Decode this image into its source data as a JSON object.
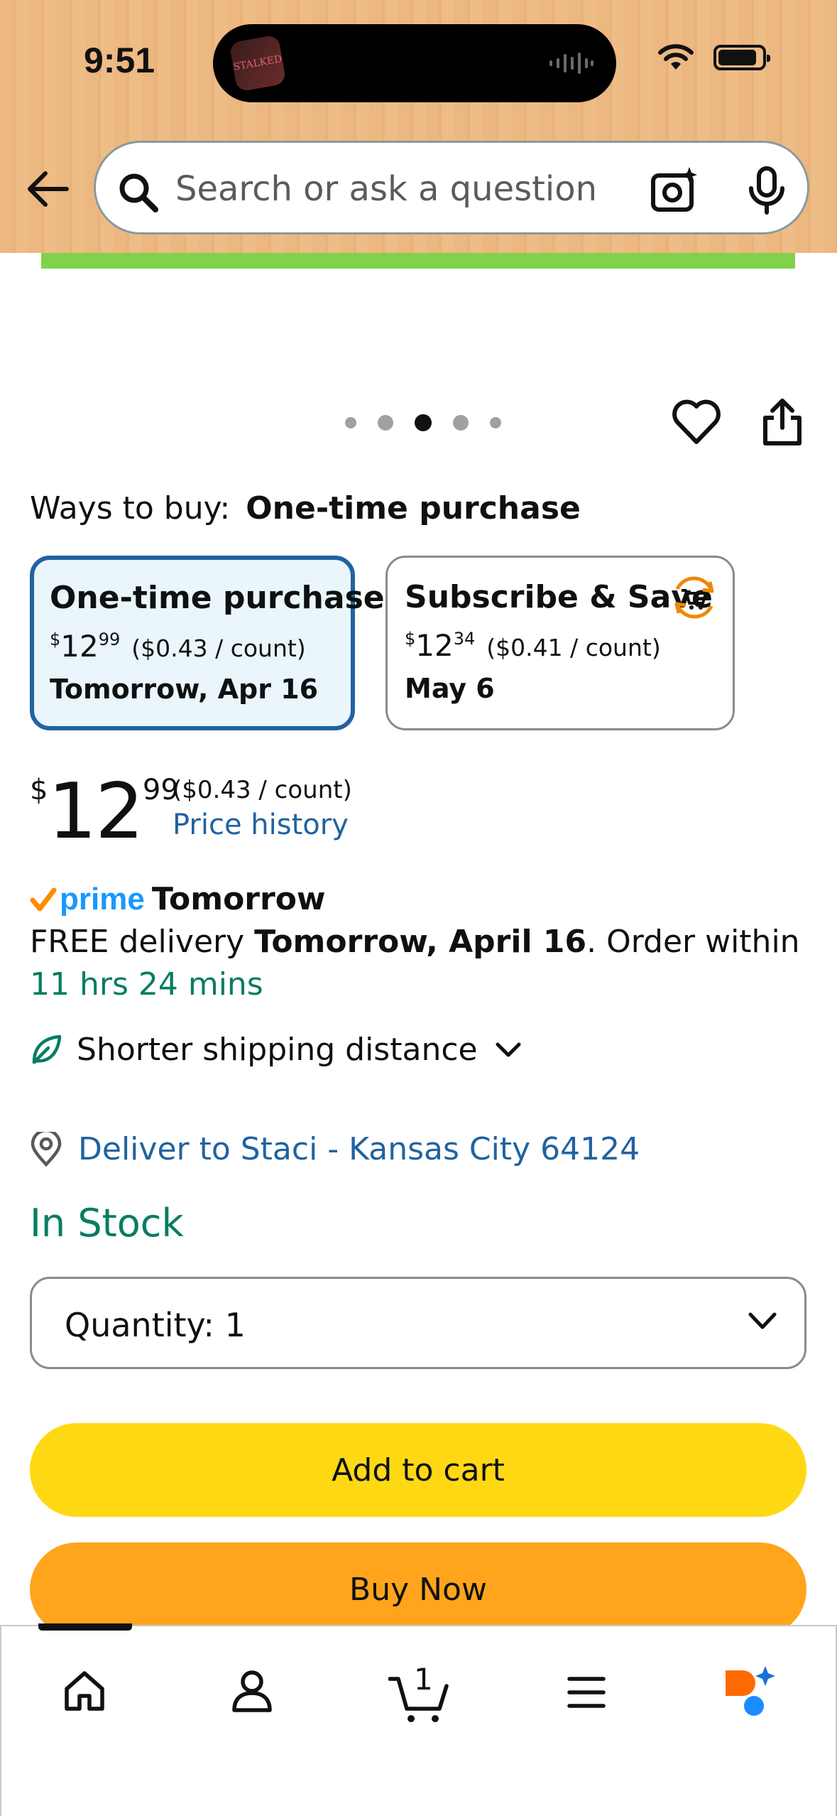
{
  "status_bar": {
    "time": "9:51",
    "island_art_text": "STALKED"
  },
  "header": {
    "search": {
      "placeholder": "Search or ask a question",
      "value": ""
    }
  },
  "carousel": {
    "total_dots": 5,
    "active_index": 2
  },
  "ways_to_buy": {
    "label": "Ways to buy:",
    "selected": "One-time purchase"
  },
  "options": [
    {
      "title": "One-time purchase",
      "currency": "$",
      "whole": "12",
      "fraction": "99",
      "unit_price": "($0.43 / count)",
      "date": "Tomorrow, Apr 16",
      "selected": true
    },
    {
      "title": "Subscribe & Save",
      "currency": "$",
      "whole": "12",
      "fraction": "34",
      "unit_price": "($0.41 / count)",
      "date": "May 6",
      "selected": false
    }
  ],
  "price": {
    "currency": "$",
    "whole": "12",
    "fraction": "99",
    "unit_price": "($0.43 / count)",
    "history_link": "Price history"
  },
  "prime": {
    "logo": "prime",
    "when": "Tomorrow",
    "delivery_prefix": "FREE delivery ",
    "delivery_date": "Tomorrow, April 16",
    "order_within": ". Order within ",
    "countdown": "11 hrs 24 mins"
  },
  "shipping": {
    "label": "Shorter shipping distance"
  },
  "deliver_to": {
    "label": "Deliver to Staci - Kansas City 64124"
  },
  "stock": {
    "label": "In Stock"
  },
  "quantity": {
    "label": "Quantity:",
    "value": "1"
  },
  "buttons": {
    "add_to_cart": "Add to cart",
    "buy_now": "Buy Now"
  },
  "bottom_nav": {
    "cart_count": "1"
  },
  "colors": {
    "header_bg": "#ecb780",
    "link_blue": "#2162a1",
    "stock_green": "#067d62",
    "add_to_cart": "#ffd814",
    "buy_now": "#ffa41c",
    "prime_blue": "#1a98ff",
    "prime_check": "#ff8a00"
  }
}
